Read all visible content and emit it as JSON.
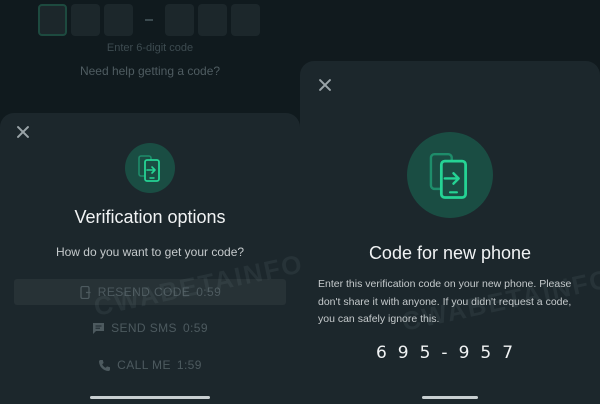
{
  "background_screen": {
    "code_hint": "Enter 6-digit code",
    "help_link": "Need help getting a code?"
  },
  "verification_options_sheet": {
    "title": "Verification options",
    "subtitle": "How do you want to get your code?",
    "options": [
      {
        "label": "RESEND CODE",
        "timer": "0:59",
        "icon": "phone-resend-icon"
      },
      {
        "label": "SEND SMS",
        "timer": "0:59",
        "icon": "message-icon"
      },
      {
        "label": "CALL ME",
        "timer": "1:59",
        "icon": "phone-call-icon"
      }
    ]
  },
  "new_phone_sheet": {
    "title": "Code for new phone",
    "body": "Enter this verification code on your new phone. Please don't share it with anyone. If you didn't request a code, you can safely ignore this.",
    "code": "695-957"
  },
  "watermark": "CWABETAINFO",
  "colors": {
    "accent": "#25d366",
    "badge_bg": "#1a4d43",
    "sheet_bg": "#1c272c"
  }
}
